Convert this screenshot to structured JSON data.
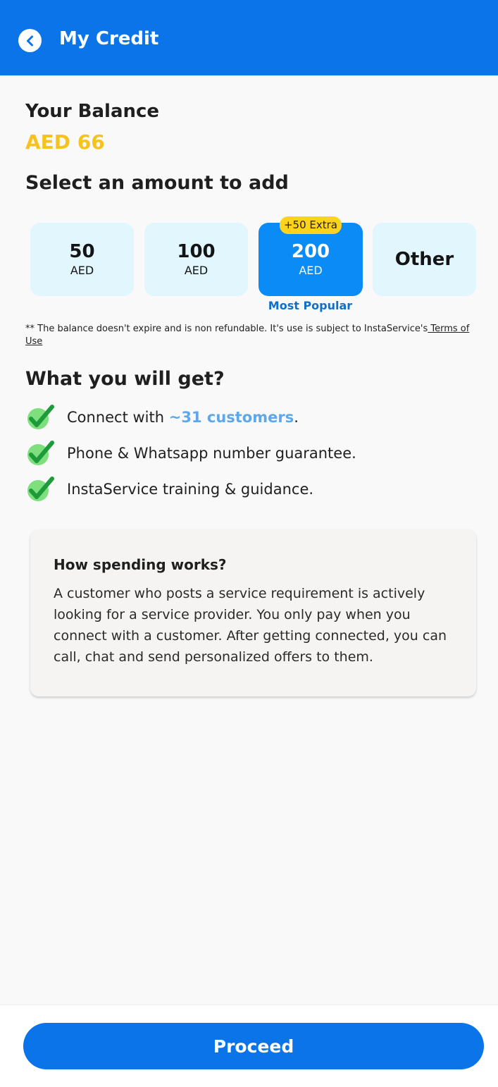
{
  "header": {
    "title": "My Credit",
    "back_icon": "chevron-left-icon"
  },
  "balance": {
    "label": "Your Balance",
    "value": "AED 66"
  },
  "amounts": {
    "title": "Select an amount to add",
    "options": [
      {
        "amount": "50",
        "currency": "AED"
      },
      {
        "amount": "100",
        "currency": "AED"
      },
      {
        "amount": "200",
        "currency": "AED",
        "badge": "+50 Extra",
        "tag": "Most Popular",
        "selected": true
      },
      {
        "label": "Other"
      }
    ]
  },
  "note": {
    "text": "** The balance doesn't expire and is non refundable. It's use is subject to InstaService's",
    "link": " Terms of Use"
  },
  "benefits": {
    "title": "What you will get?",
    "items": [
      {
        "prefix": "Connect with ",
        "highlight": "~31 customers",
        "suffix": "."
      },
      {
        "text": "Phone & Whatsapp number guarantee."
      },
      {
        "text": "InstaService training & guidance."
      }
    ]
  },
  "info": {
    "title": "How spending works?",
    "body": "A customer who posts a service requirement is actively looking for a service provider. You only pay when you connect with a customer. After getting connected, you can call, chat and send personalized offers to them."
  },
  "footer": {
    "proceed_label": "Proceed"
  },
  "colors": {
    "primary": "#0a74e8",
    "balance": "#f6c21d",
    "card_bg": "#e2f6fe",
    "selected_card": "#0a8bf5",
    "badge": "#ffd21e",
    "check": "#2bb84a"
  }
}
